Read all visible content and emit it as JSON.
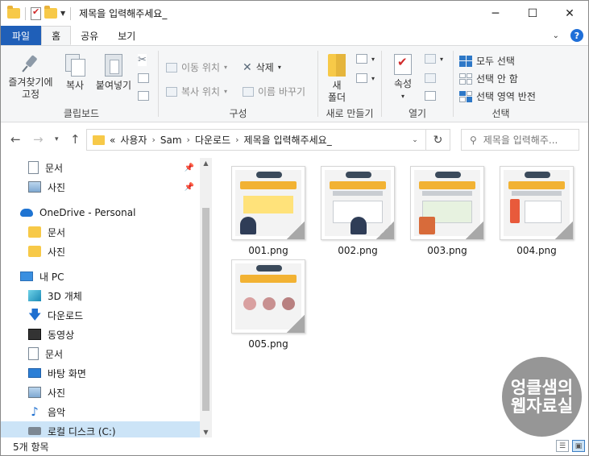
{
  "window": {
    "title": "제목을 입력해주세요_",
    "controls": {
      "minimize": "─",
      "maximize": "☐",
      "close": "✕"
    }
  },
  "ribbon_tabs": [
    {
      "label": "파일"
    },
    {
      "label": "홈"
    },
    {
      "label": "공유"
    },
    {
      "label": "보기"
    }
  ],
  "ribbon": {
    "clipboard": {
      "label": "클립보드",
      "pin_line1": "즐겨찾기에",
      "pin_line2": "고정",
      "copy": "복사",
      "paste": "붙여넣기"
    },
    "organize": {
      "label": "구성",
      "move_to": "이동 위치",
      "copy_to": "복사 위치",
      "delete": "삭제",
      "rename": "이름 바꾸기"
    },
    "new": {
      "label": "새로 만들기",
      "new_folder_line1": "새",
      "new_folder_line2": "폴더"
    },
    "open": {
      "label": "열기",
      "properties": "속성"
    },
    "select": {
      "label": "선택",
      "select_all": "모두 선택",
      "select_none": "선택 안 함",
      "invert": "선택 영역 반전"
    }
  },
  "address": {
    "overflow": "«",
    "crumbs": [
      "사용자",
      "Sam",
      "다운로드",
      "제목을 입력해주세요_"
    ],
    "search_placeholder": "제목을 입력해주..."
  },
  "nav_pane": {
    "items": [
      {
        "label": "문서",
        "pinned": true
      },
      {
        "label": "사진",
        "pinned": true
      },
      {
        "label": "OneDrive - Personal"
      },
      {
        "label": "문서"
      },
      {
        "label": "사진"
      },
      {
        "label": "내 PC"
      },
      {
        "label": "3D 개체"
      },
      {
        "label": "다운로드"
      },
      {
        "label": "동영상"
      },
      {
        "label": "문서"
      },
      {
        "label": "바탕 화면"
      },
      {
        "label": "사진"
      },
      {
        "label": "음악"
      },
      {
        "label": "로컬 디스크 (C:)"
      }
    ]
  },
  "files": [
    {
      "name": "001.png",
      "accent": "#f2b233"
    },
    {
      "name": "002.png",
      "accent": "#f2b233"
    },
    {
      "name": "003.png",
      "accent": "#f2b233"
    },
    {
      "name": "004.png",
      "accent": "#f2b233"
    },
    {
      "name": "005.png",
      "accent": "#f2b233"
    }
  ],
  "status": {
    "count": "5개 항목"
  },
  "watermark": {
    "line1": "엉클샘의",
    "line2": "웹자료실"
  },
  "colors": {
    "file_tab": "#1f5fb8",
    "selected": "#cce4f7",
    "folder": "#f7c948"
  }
}
